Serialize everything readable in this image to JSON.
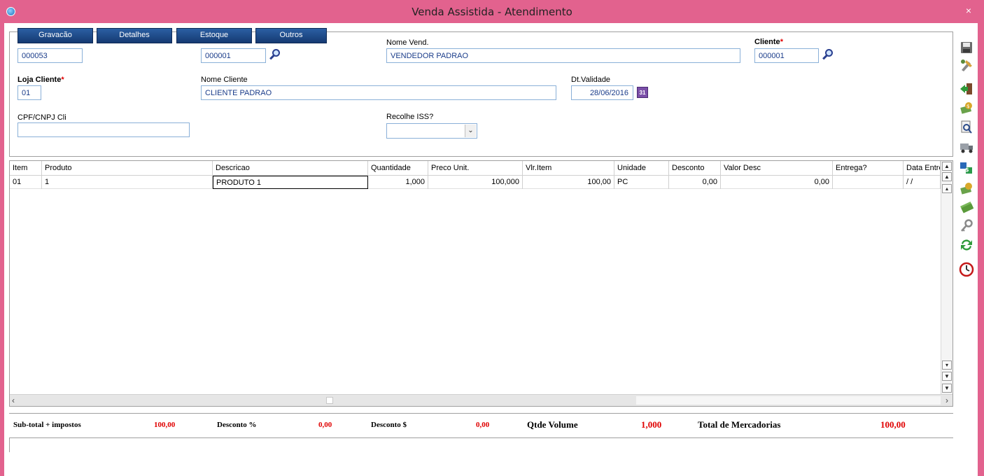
{
  "window": {
    "title": "Venda Assistida - Atendimento",
    "close": "×"
  },
  "tabs": [
    "Gravacão",
    "Detalhes",
    "Estoque",
    "Outros"
  ],
  "form": {
    "orcamento_value": "000053",
    "vendedor_value": "000001",
    "nome_vend_label": "Nome Vend.",
    "nome_vend_value": "VENDEDOR PADRAO",
    "cliente_label": "Cliente",
    "cliente_value": "000001",
    "loja_label": "Loja Cliente",
    "loja_value": "01",
    "nome_cliente_label": "Nome Cliente",
    "nome_cliente_value": "CLIENTE PADRAO",
    "validade_label": "Dt.Validade",
    "validade_value": "28/06/2016",
    "cpf_label": "CPF/CNPJ Cli",
    "cpf_value": "",
    "iss_label": "Recolhe ISS?",
    "iss_value": "",
    "required_mark": "*",
    "calendar_glyph": "31"
  },
  "grid": {
    "columns": [
      "Item",
      "Produto",
      "Descricao",
      "Quantidade",
      "Preco Unit.",
      "Vlr.Item",
      "Unidade",
      "Desconto",
      "Valor Desc",
      "Entrega?",
      "Data Entre"
    ],
    "rows": [
      [
        "01",
        "1",
        "PRODUTO 1",
        "1,000",
        "100,000",
        "100,00",
        "PC",
        "0,00",
        "0,00",
        "",
        "/ /"
      ]
    ]
  },
  "totals": {
    "subtotal_label": "Sub-total + impostos",
    "subtotal_value": "100,00",
    "desc_pct_label": "Desconto %",
    "desc_pct_value": "0,00",
    "desc_val_label": "Desconto $",
    "desc_val_value": "0,00",
    "volume_label": "Qtde Volume",
    "volume_value": "1,000",
    "mercadorias_label": "Total de Mercadorias",
    "mercadorias_value": "100,00"
  },
  "side_toolbar": [
    "save-icon",
    "edit-tools-icon",
    "exit-icon",
    "payment-icon",
    "search-document-icon",
    "delivery-truck-icon",
    "exchange-icon",
    "money-icon",
    "cash-icon",
    "key-icon",
    "refresh-icon",
    "clock-icon"
  ],
  "colors": {
    "title_bar": "#e2628e",
    "tab_button": "#1e4a8c",
    "total_value": "#e00000",
    "field_text": "#1a3c8a"
  }
}
